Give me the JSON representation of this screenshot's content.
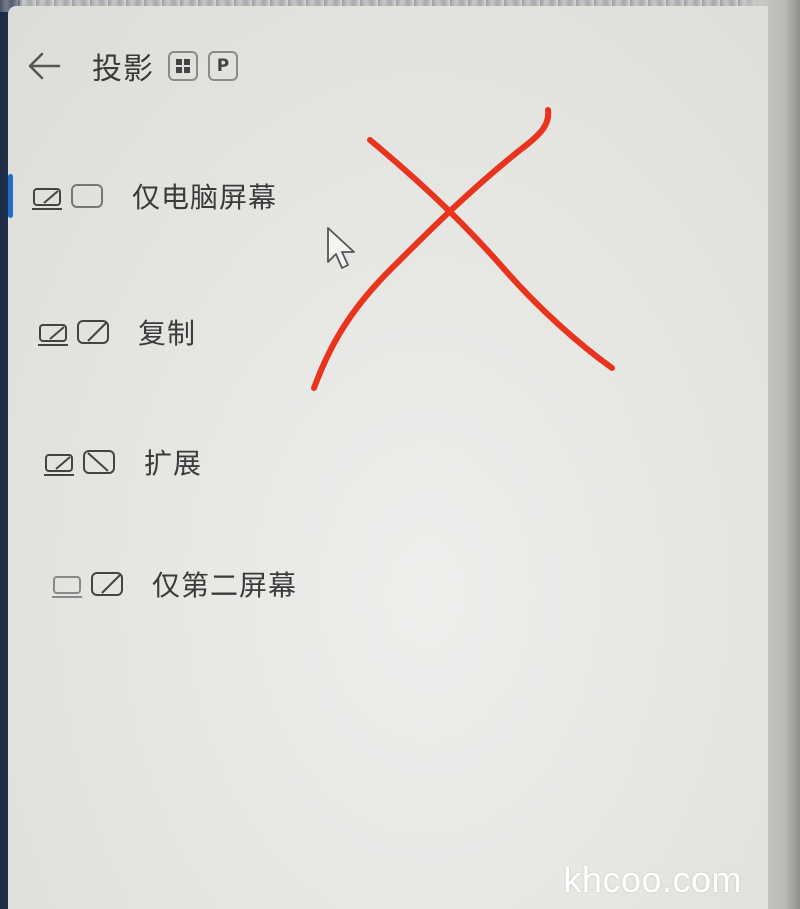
{
  "header": {
    "title": "投影",
    "back_icon": "arrow-left-icon",
    "shortcut": {
      "win_key_icon": "windows-logo-icon",
      "letter_key": "P"
    }
  },
  "options": [
    {
      "label": "仅电脑屏幕",
      "icon": "pc-screen-only-icon",
      "selected": true
    },
    {
      "label": "复制",
      "icon": "duplicate-icon",
      "selected": false
    },
    {
      "label": "扩展",
      "icon": "extend-icon",
      "selected": false
    },
    {
      "label": "仅第二屏幕",
      "icon": "second-screen-only-icon",
      "selected": false
    }
  ],
  "overlay": {
    "mark": "red-x-annotation",
    "color": "#e8341c"
  },
  "accent_color": "#1f6fc4",
  "watermark": "khcoo.com"
}
